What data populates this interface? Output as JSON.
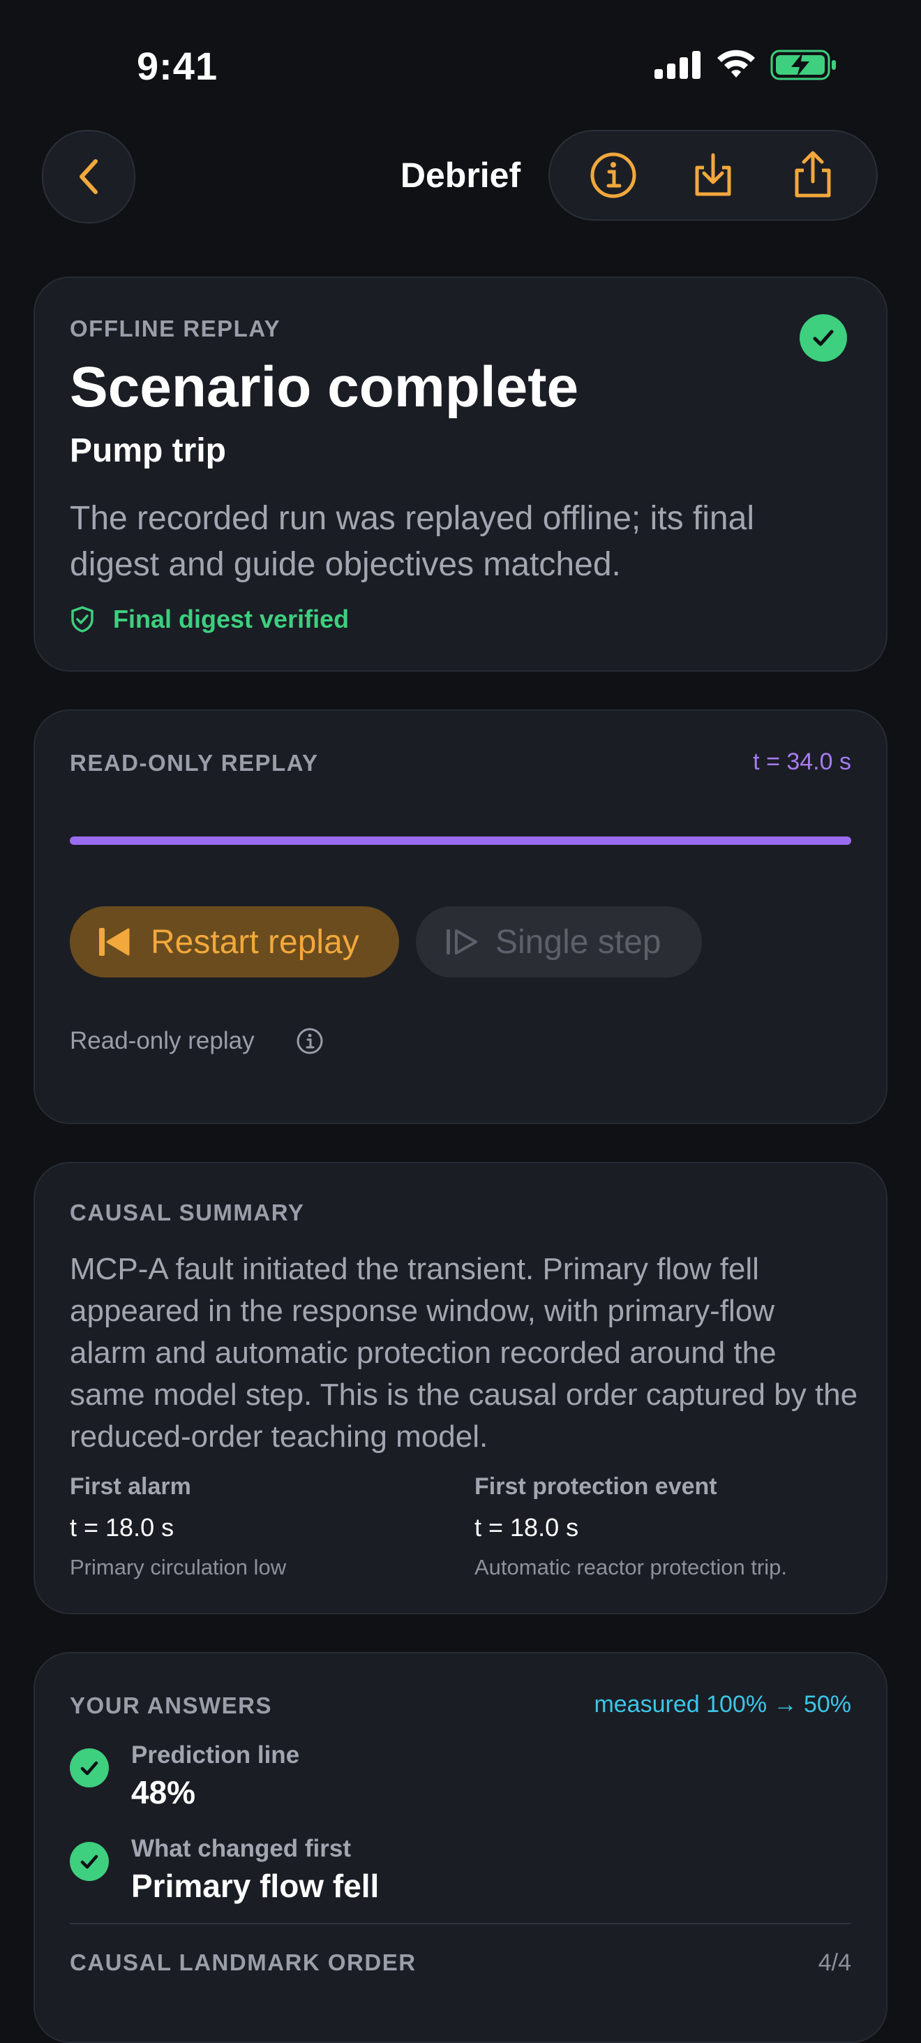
{
  "status_bar": {
    "time": "9:41"
  },
  "nav": {
    "title": "Debrief"
  },
  "colors": {
    "accent": "#f2a83c",
    "success": "#3ecf7f",
    "replay": "#9a6cf0",
    "measured": "#3cc6e8"
  },
  "outcome": {
    "eyebrow": "OFFLINE REPLAY",
    "title": "Scenario complete",
    "subtitle": "Pump trip",
    "description": "The recorded run was replayed offline; its final digest and guide objectives matched.",
    "verified_label": "Final digest verified"
  },
  "replay": {
    "eyebrow": "READ-ONLY REPLAY",
    "time": "t = 34.0 s",
    "progress_fraction": 1.0,
    "restart_label": "Restart replay",
    "step_label": "Single step",
    "readonly_label": "Read-only replay"
  },
  "causal": {
    "eyebrow": "CAUSAL SUMMARY",
    "summary": "MCP-A fault initiated the transient. Primary flow fell appeared in the response window, with primary-flow alarm and automatic protection recorded around the same model step. This is the causal order captured by the reduced-order teaching model.",
    "first_alarm": {
      "heading": "First alarm",
      "time": "t = 18.0 s",
      "detail": "Primary circulation low"
    },
    "first_protection": {
      "heading": "First protection event",
      "time": "t = 18.0 s",
      "detail": "Automatic reactor protection trip."
    }
  },
  "answers": {
    "eyebrow": "YOUR ANSWERS",
    "measured": "measured 100% → 50%",
    "items": [
      {
        "label": "Prediction line",
        "value": "48%"
      },
      {
        "label": "What changed first",
        "value": "Primary flow fell"
      }
    ],
    "landmark_label": "CAUSAL LANDMARK ORDER",
    "landmark_count": "4/4"
  }
}
